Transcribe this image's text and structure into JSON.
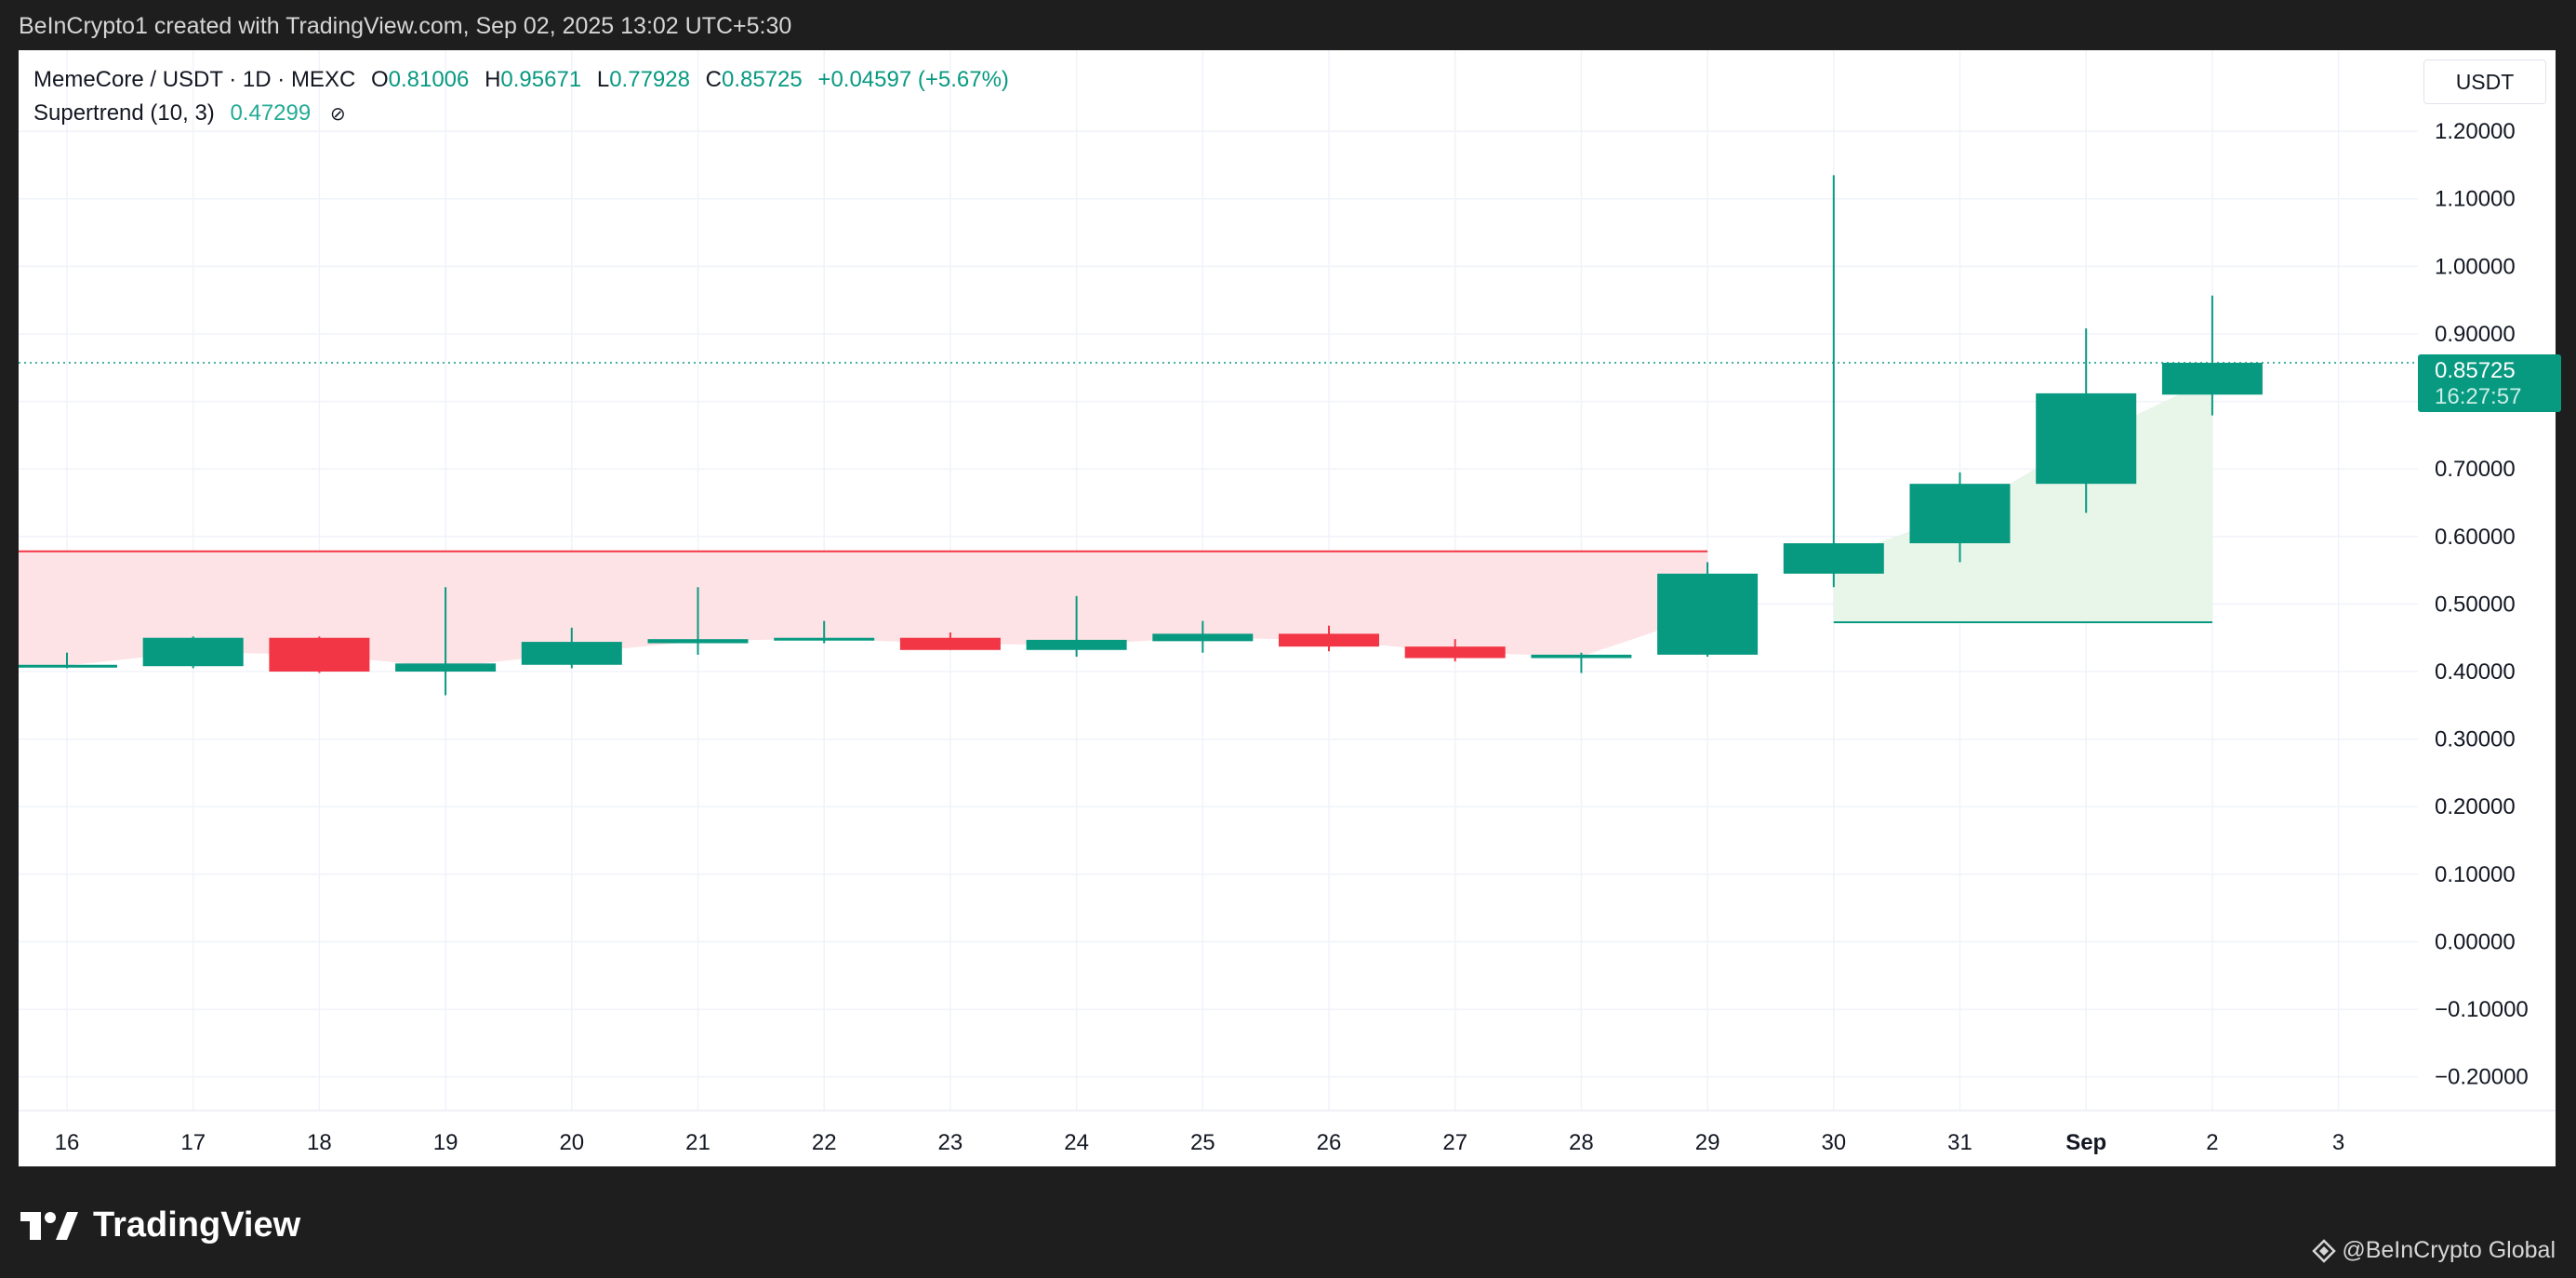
{
  "header": {
    "caption": "BeInCrypto1 created with TradingView.com, Sep 02, 2025 13:02 UTC+5:30"
  },
  "legend": {
    "symbol": "MemeCore / USDT · 1D · MEXC",
    "open_label": "O",
    "open": "0.81006",
    "high_label": "H",
    "high": "0.95671",
    "low_label": "L",
    "low": "0.77928",
    "close_label": "C",
    "close": "0.85725",
    "change": "+0.04597 (+5.67%)",
    "indicator": "Supertrend (10, 3)",
    "indicator_value": "0.47299",
    "visibility_icon": "eye-off-icon"
  },
  "currency": "USDT",
  "price_tag": {
    "price": "0.85725",
    "countdown": "16:27:57"
  },
  "footer": {
    "brand": "TradingView",
    "credit": "@BeInCrypto Global"
  },
  "colors": {
    "up": "#089981",
    "down": "#f23645",
    "supertrend_up_fill": "#e8f5e9",
    "supertrend_down_fill": "#fde3e5",
    "grid": "#f0f3fa"
  },
  "chart_data": {
    "type": "candlestick",
    "x_labels": [
      "16",
      "17",
      "18",
      "19",
      "20",
      "21",
      "22",
      "23",
      "24",
      "25",
      "26",
      "27",
      "28",
      "29",
      "30",
      "31",
      "Sep",
      "2",
      "3"
    ],
    "y_ticks": [
      "1.20000",
      "1.10000",
      "1.00000",
      "0.90000",
      "0.80000",
      "0.70000",
      "0.60000",
      "0.50000",
      "0.40000",
      "0.30000",
      "0.20000",
      "0.10000",
      "0.00000",
      "−0.10000",
      "−0.20000"
    ],
    "y_tick_values": [
      1.2,
      1.1,
      1.0,
      0.9,
      0.8,
      0.7,
      0.6,
      0.5,
      0.4,
      0.3,
      0.2,
      0.1,
      0.0,
      -0.1,
      -0.2
    ],
    "ylim": [
      -0.25,
      1.32
    ],
    "candles": [
      {
        "x": "16",
        "open": 0.408,
        "high": 0.428,
        "low": 0.405,
        "close": 0.41
      },
      {
        "x": "17",
        "open": 0.408,
        "high": 0.452,
        "low": 0.405,
        "close": 0.45
      },
      {
        "x": "18",
        "open": 0.45,
        "high": 0.452,
        "low": 0.398,
        "close": 0.4
      },
      {
        "x": "19",
        "open": 0.4,
        "high": 0.525,
        "low": 0.365,
        "close": 0.412
      },
      {
        "x": "20",
        "open": 0.41,
        "high": 0.465,
        "low": 0.405,
        "close": 0.444
      },
      {
        "x": "21",
        "open": 0.442,
        "high": 0.525,
        "low": 0.425,
        "close": 0.448
      },
      {
        "x": "22",
        "open": 0.448,
        "high": 0.475,
        "low": 0.442,
        "close": 0.45
      },
      {
        "x": "23",
        "open": 0.45,
        "high": 0.458,
        "low": 0.432,
        "close": 0.432
      },
      {
        "x": "24",
        "open": 0.432,
        "high": 0.512,
        "low": 0.422,
        "close": 0.447
      },
      {
        "x": "25",
        "open": 0.445,
        "high": 0.475,
        "low": 0.428,
        "close": 0.456
      },
      {
        "x": "26",
        "open": 0.456,
        "high": 0.468,
        "low": 0.43,
        "close": 0.437
      },
      {
        "x": "27",
        "open": 0.437,
        "high": 0.448,
        "low": 0.415,
        "close": 0.42
      },
      {
        "x": "28",
        "open": 0.42,
        "high": 0.428,
        "low": 0.398,
        "close": 0.425
      },
      {
        "x": "29",
        "open": 0.425,
        "high": 0.562,
        "low": 0.422,
        "close": 0.545
      },
      {
        "x": "30",
        "open": 0.545,
        "high": 1.135,
        "low": 0.525,
        "close": 0.59
      },
      {
        "x": "31",
        "open": 0.59,
        "high": 0.695,
        "low": 0.562,
        "close": 0.678
      },
      {
        "x": "Sep",
        "open": 0.678,
        "high": 0.908,
        "low": 0.635,
        "close": 0.812
      },
      {
        "x": "2",
        "open": 0.81006,
        "high": 0.95671,
        "low": 0.77928,
        "close": 0.85725
      }
    ],
    "supertrend": {
      "name": "Supertrend (10, 3)",
      "down_line": {
        "value": 0.578,
        "from": "16",
        "to": "29"
      },
      "up_line": {
        "value": 0.47299,
        "from": "30",
        "to": "2"
      }
    },
    "last_price": 0.85725
  }
}
